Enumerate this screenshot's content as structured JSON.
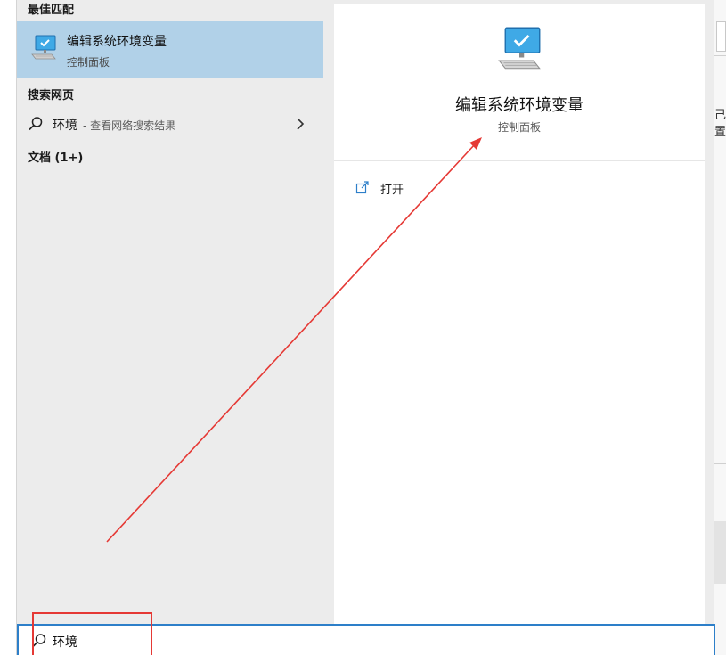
{
  "results": {
    "best_match_header": "最佳匹配",
    "best_match": {
      "title": "编辑系统环境变量",
      "subtitle": "控制面板",
      "icon": "monitor-settings-icon"
    },
    "web_header": "搜索网页",
    "web_item": {
      "query": "环境",
      "hint": "- 查看网络搜索结果",
      "icon": "search-icon"
    },
    "docs_header": "文档 (1+)"
  },
  "preview": {
    "title": "编辑系统环境变量",
    "subtitle": "控制面板",
    "actions": [
      {
        "label": "打开",
        "icon": "open-icon"
      }
    ]
  },
  "search": {
    "value": "环境",
    "icon": "search-icon"
  },
  "background_window": {
    "fragment_text": "己置"
  },
  "colors": {
    "selection": "#b1d1e8",
    "accent": "#2d7fc9",
    "annotation": "#e53935"
  }
}
